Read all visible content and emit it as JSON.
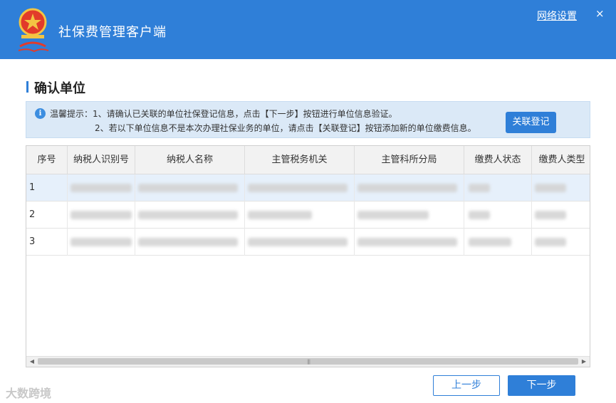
{
  "titlebar": {
    "app_title": "社保费管理客户端",
    "net_settings": "网络设置",
    "close": "×"
  },
  "section": {
    "title": "确认单位"
  },
  "tip": {
    "line1": "温馨提示：1、请确认已关联的单位社保登记信息，点击【下一步】按钮进行单位信息验证。",
    "line2": "2、若以下单位信息不是本次办理社保业务的单位，请点击【关联登记】按钮添加新的单位缴费信息。"
  },
  "link_button": "关联登记",
  "table": {
    "columns": [
      "序号",
      "纳税人识别号",
      "纳税人名称",
      "主管税务机关",
      "主管科所分局",
      "缴费人状态",
      "缴费人类型"
    ],
    "rows": [
      {
        "index": "1",
        "selected": true
      },
      {
        "index": "2",
        "selected": false
      },
      {
        "index": "3",
        "selected": false
      }
    ]
  },
  "footer": {
    "prev": "上一步",
    "next": "下一步"
  },
  "watermark": "大数跨境",
  "colors": {
    "brand": "#2f7fd8",
    "tip_bg": "#dbe9f7",
    "selected_row": "#e6f0fb"
  },
  "icons": [
    "tax-emblem-logo",
    "info-icon",
    "close-icon",
    "scroll-left-arrow-icon",
    "scroll-right-arrow-icon"
  ]
}
